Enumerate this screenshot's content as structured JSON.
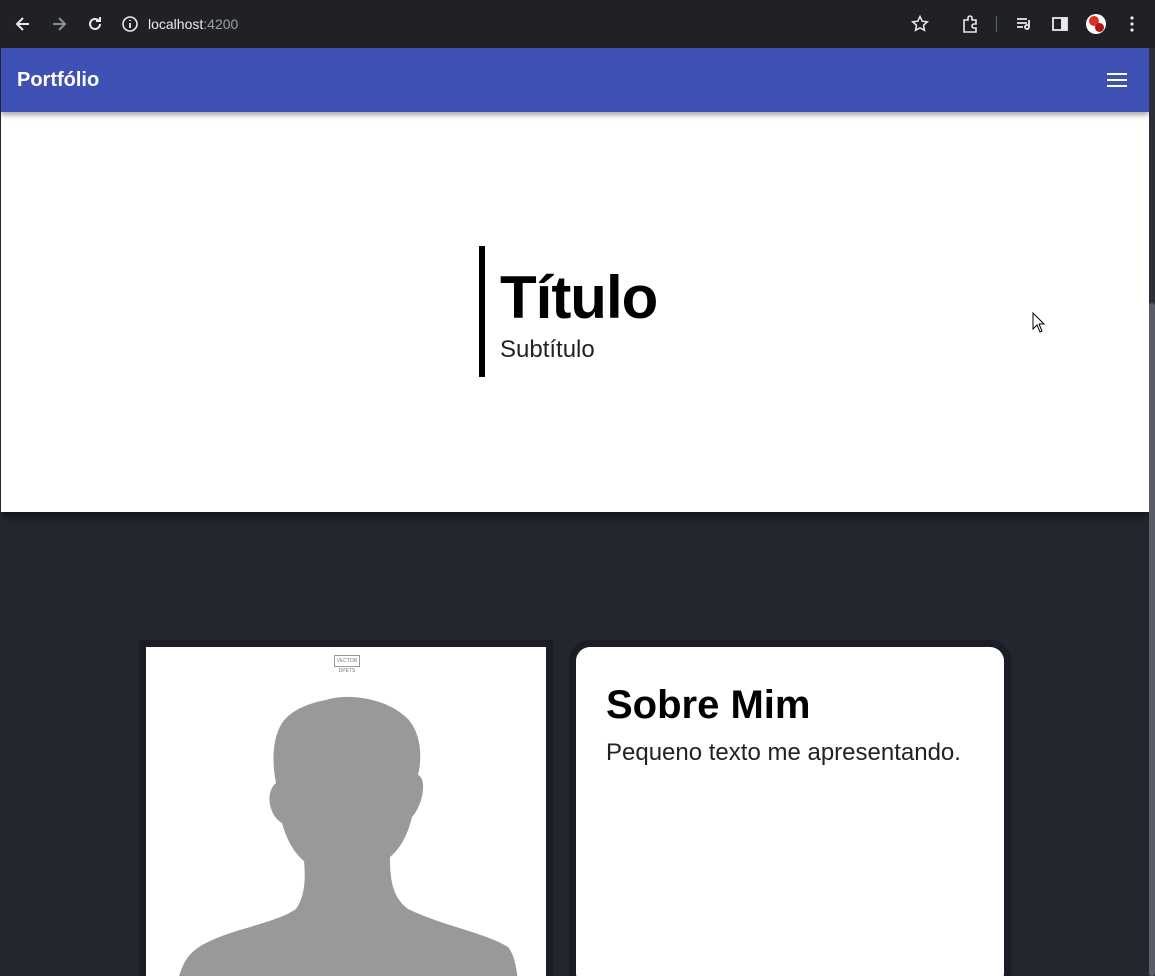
{
  "browser": {
    "url_host": "localhost",
    "url_port": ":4200",
    "icons": [
      "back-arrow-icon",
      "forward-arrow-icon",
      "reload-icon",
      "site-info-icon",
      "bookmark-star-icon",
      "extensions-icon",
      "media-control-icon",
      "side-panel-icon",
      "profile-avatar-icon",
      "more-menu-icon"
    ]
  },
  "toolbar": {
    "brand": "Portfólio",
    "menu_icon": "hamburger-menu-icon",
    "color": "#3f51b5"
  },
  "hero": {
    "title": "Título",
    "subtitle": "Subtítulo"
  },
  "about": {
    "title": "Sobre Mim",
    "text": "Pequeno texto me apresentando."
  },
  "photo": {
    "watermark": "VECTOR DPETS"
  },
  "colors": {
    "background": "#23252f",
    "card": "#ffffff",
    "silhouette": "#999999"
  }
}
